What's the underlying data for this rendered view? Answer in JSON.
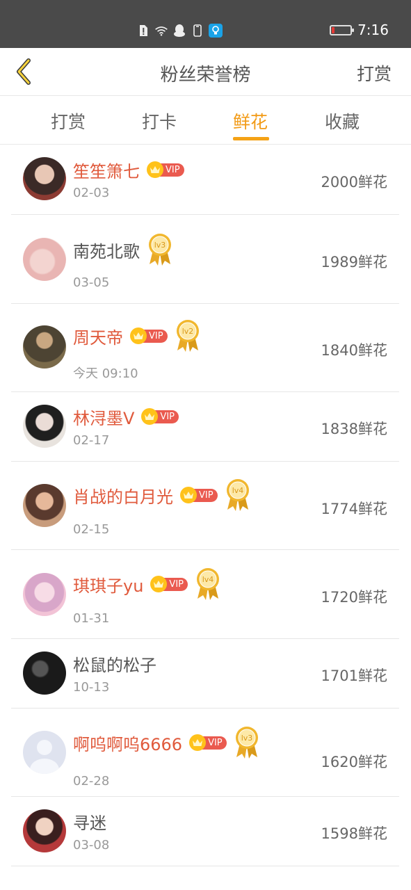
{
  "status_bar": {
    "time": "7:16",
    "icons": [
      "sim-alert-icon",
      "wifi-icon",
      "qq-penguin-icon",
      "phone-icon",
      "lightbulb-app-icon"
    ],
    "battery_color": "#e53935"
  },
  "nav": {
    "title": "粉丝荣誉榜",
    "action": "打赏",
    "back_icon": "chevron-left-icon"
  },
  "tabs": [
    {
      "label": "打赏",
      "active": false
    },
    {
      "label": "打卡",
      "active": false
    },
    {
      "label": "鲜花",
      "active": true
    },
    {
      "label": "收藏",
      "active": false
    }
  ],
  "colors": {
    "accent": "#f29b17",
    "vip_name": "#e05a3c",
    "vip_tag": "#ea5a4f",
    "crown": "#ffc21a",
    "medal": "#e8a927"
  },
  "vip_label": "VIP",
  "fans": [
    {
      "name": "笙笙箫七",
      "date": "02-03",
      "amount": "2000鲜花",
      "vip": true,
      "level": null
    },
    {
      "name": "南苑北歌",
      "date": "03-05",
      "amount": "1989鲜花",
      "vip": false,
      "level": "lv3"
    },
    {
      "name": "周天帝",
      "date": "今天 09:10",
      "amount": "1840鲜花",
      "vip": true,
      "level": "lv2"
    },
    {
      "name": "林浔墨V",
      "date": "02-17",
      "amount": "1838鲜花",
      "vip": true,
      "level": null
    },
    {
      "name": "肖战的白月光",
      "date": "02-15",
      "amount": "1774鲜花",
      "vip": true,
      "level": "lv4"
    },
    {
      "name": "琪琪子yu",
      "date": "01-31",
      "amount": "1720鲜花",
      "vip": true,
      "level": "lv4"
    },
    {
      "name": "松鼠的松子",
      "date": "10-13",
      "amount": "1701鲜花",
      "vip": false,
      "level": null
    },
    {
      "name": "啊呜啊呜6666",
      "date": "02-28",
      "amount": "1620鲜花",
      "vip": true,
      "level": "lv3"
    },
    {
      "name": "寻迷",
      "date": "03-08",
      "amount": "1598鲜花",
      "vip": false,
      "level": null
    }
  ]
}
